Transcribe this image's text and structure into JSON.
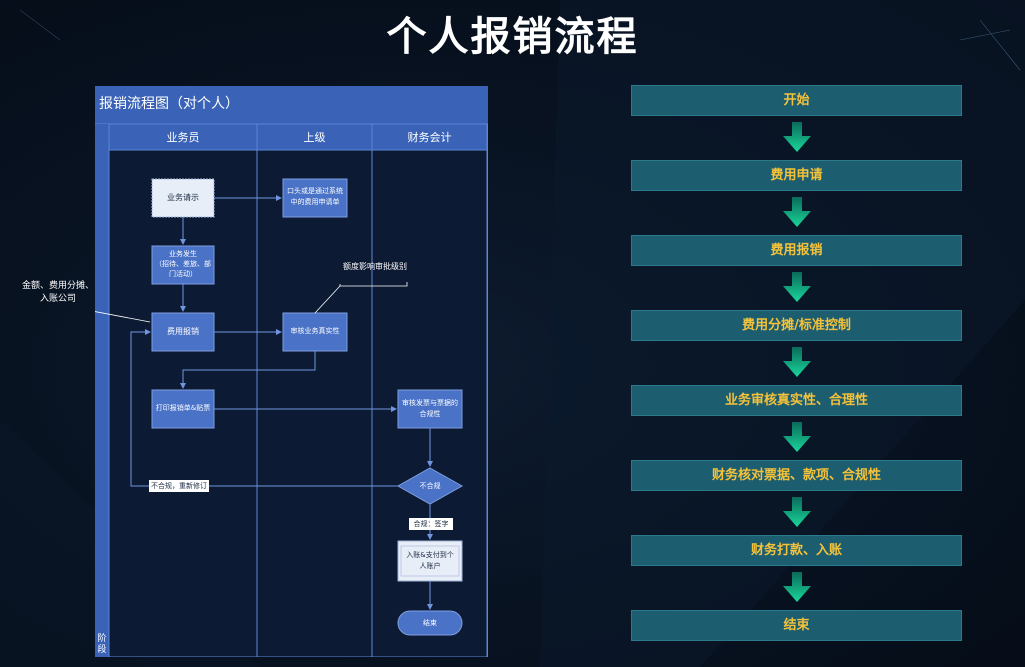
{
  "page_title": "个人报销流程",
  "diagram": {
    "title": "报销流程图（对个人）",
    "lanes": [
      "业务员",
      "上级",
      "财务会计"
    ],
    "phase_label": "阶段",
    "side_note": "金额、费用分摊、入账公司",
    "annotation": "额度影响审批级别",
    "nodes": {
      "business_request": "业务请示",
      "business_occur": "业务发生\n（招待、差旅、部门活动）",
      "expense_claim": "费用报销",
      "print_attach": "打印报销单&贴票",
      "oral_or_system": "口头或是通过系统中的费用申请单",
      "review_real": "审核业务真实性",
      "review_invoice": "审核发票与票据的合规性",
      "non_compliant": "不合规",
      "entry_pay": "入账&支付到个人账户",
      "end": "结束"
    },
    "edge_labels": {
      "reject": "不合规，重新修订",
      "approve": "合规：签字"
    }
  },
  "flow_steps": [
    "开始",
    "费用申请",
    "费用报销",
    "费用分摊/标准控制",
    "业务审核真实性、合理性",
    "财务核对票据、款项、合规性",
    "财务打款、入账",
    "结束"
  ],
  "colors": {
    "step_bg": "#1d5d70",
    "step_text": "#f4c23a",
    "arrow": "#19c08c",
    "node_fill": "#4a72c6",
    "lane_border": "#5b86d6"
  }
}
